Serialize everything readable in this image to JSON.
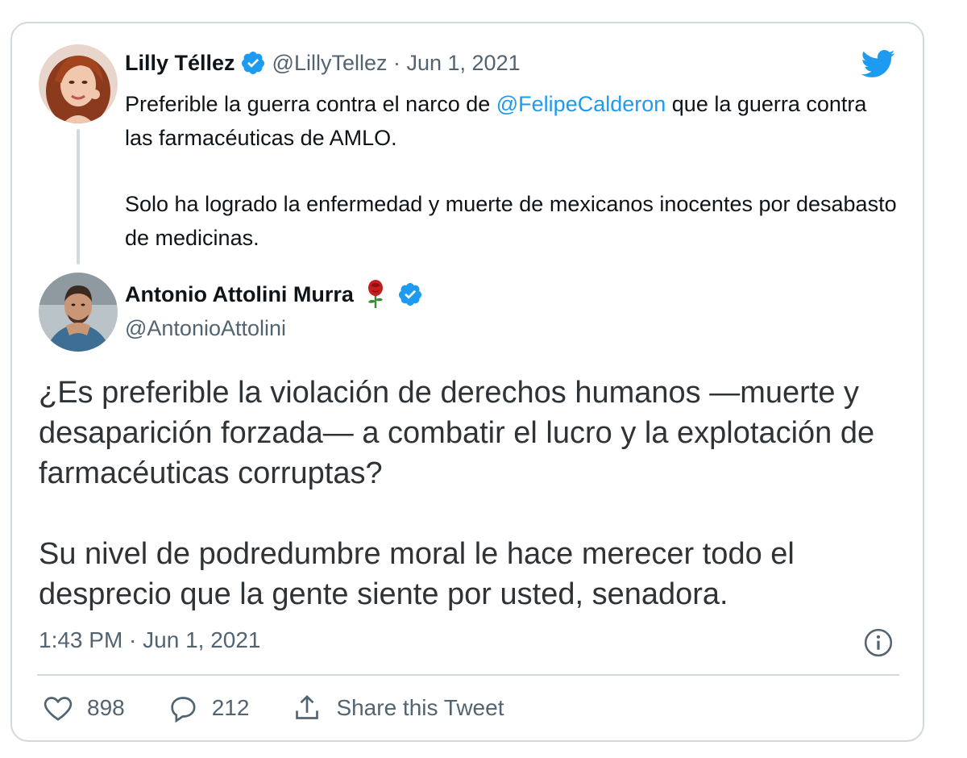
{
  "quoted_tweet": {
    "author_name": "Lilly Téllez",
    "handle_date": "@LillyTellez · Jun 1, 2021",
    "text_before_mention": "Preferible la guerra contra el narco de ",
    "mention": "@FelipeCalderon",
    "text_after_mention": " que la guerra contra las farmacéuticas de AMLO.",
    "text_paragraph_2": "Solo ha logrado la enfermedad y muerte de mexicanos inocentes por desabasto de medicinas."
  },
  "reply_tweet": {
    "author_name": "Antonio Attolini Murra",
    "handle": "@AntonioAttolini",
    "paragraph_1": "¿Es preferible la violación de derechos humanos —muerte y desaparición forzada— a combatir el lucro y la explotación de farmacéuticas corruptas?",
    "paragraph_2": "Su nivel de podredumbre moral le hace merecer todo el desprecio que la gente siente por usted, senadora.",
    "timestamp": "1:43 PM · Jun 1, 2021"
  },
  "actions": {
    "likes": "898",
    "replies": "212",
    "share_label": "Share this Tweet"
  },
  "icons": {
    "logo": "twitter-bird-icon",
    "verified": "verified-badge-icon",
    "info": "info-icon",
    "like": "heart-icon",
    "reply": "comment-icon",
    "share": "share-icon",
    "emoji": "rose-icon"
  },
  "colors": {
    "accent": "#1d9bf0",
    "text_primary": "#0f1419",
    "text_secondary": "#536471",
    "border": "#cfd9de"
  }
}
